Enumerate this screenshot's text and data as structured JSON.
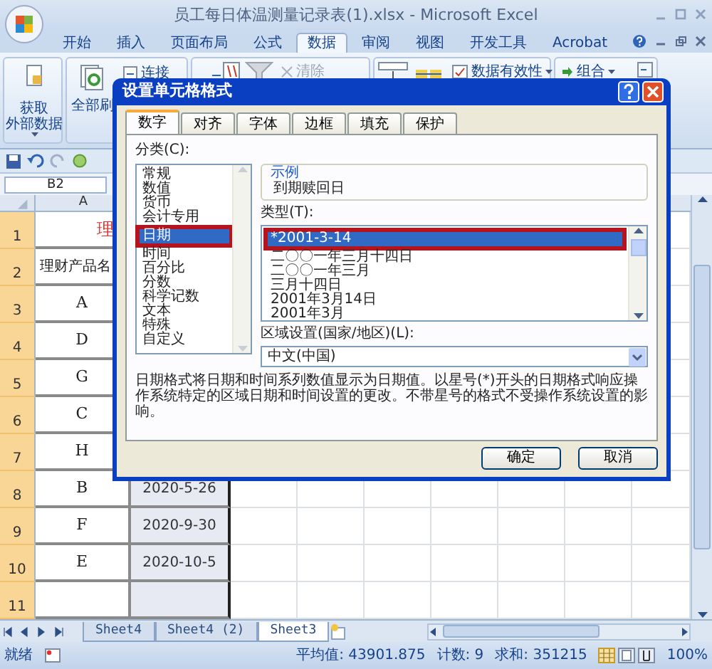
{
  "window": {
    "title": "员工每日体温测量记录表(1).xlsx - Microsoft Excel"
  },
  "ribbon_tabs": [
    {
      "label": "开始",
      "selected": false
    },
    {
      "label": "插入",
      "selected": false
    },
    {
      "label": "页面布局",
      "selected": false
    },
    {
      "label": "公式",
      "selected": false
    },
    {
      "label": "数据",
      "selected": true
    },
    {
      "label": "审阅",
      "selected": false
    },
    {
      "label": "视图",
      "selected": false
    },
    {
      "label": "开发工具",
      "selected": false
    },
    {
      "label": "Acrobat",
      "selected": false
    }
  ],
  "ribbon": {
    "get_data": {
      "lines": [
        "获取",
        "外部数据"
      ]
    },
    "refresh": {
      "label": "全部刷"
    },
    "connections": {
      "label": "连接",
      "disabled": false
    },
    "clear": {
      "label": "清除",
      "disabled": true
    },
    "validation": {
      "label": "数据有效性",
      "disabled": false
    },
    "group": {
      "label": "组合",
      "disabled": false
    }
  },
  "name_box": "B2",
  "columns": [
    "A"
  ],
  "rows": [
    {
      "header": "1",
      "kind": "title",
      "a": "理"
    },
    {
      "header": "2",
      "kind": "heading",
      "a": "理财产品名"
    },
    {
      "header": "3",
      "kind": "data",
      "a": "A"
    },
    {
      "header": "4",
      "kind": "data",
      "a": "D"
    },
    {
      "header": "5",
      "kind": "data",
      "a": "G"
    },
    {
      "header": "6",
      "kind": "data",
      "a": "C"
    },
    {
      "header": "7",
      "kind": "data",
      "a": "H"
    },
    {
      "header": "8",
      "kind": "data",
      "a": "B",
      "b": "2020-5-26",
      "b_selected": true
    },
    {
      "header": "9",
      "kind": "data",
      "a": "F",
      "b": "2020-9-30",
      "b_selected": true
    },
    {
      "header": "10",
      "kind": "data",
      "a": "E",
      "b": "2020-10-5",
      "b_selected": true
    },
    {
      "header": "11",
      "kind": "data",
      "b_selected": true
    }
  ],
  "sheet_tabs": [
    {
      "label": "Sheet4",
      "selected": false
    },
    {
      "label": "Sheet4 (2)",
      "selected": false
    },
    {
      "label": "Sheet3",
      "selected": true
    }
  ],
  "status_bar": {
    "ready": "就绪",
    "average": "平均值: 43901.875",
    "count": "计数: 9",
    "sum": "求和: 351215",
    "zoom": "100%"
  },
  "dialog": {
    "title": "设置单元格格式",
    "tabs": [
      {
        "label": "数字",
        "selected": true
      },
      {
        "label": "对齐",
        "selected": false
      },
      {
        "label": "字体",
        "selected": false
      },
      {
        "label": "边框",
        "selected": false
      },
      {
        "label": "填充",
        "selected": false
      },
      {
        "label": "保护",
        "selected": false
      }
    ],
    "category_label": "分类(C):",
    "categories": [
      {
        "label": "常规",
        "selected": false,
        "highlighted": false
      },
      {
        "label": "数值",
        "selected": false,
        "highlighted": false
      },
      {
        "label": "货币",
        "selected": false,
        "highlighted": false
      },
      {
        "label": "会计专用",
        "selected": false,
        "highlighted": false
      },
      {
        "label": "日期",
        "selected": true,
        "highlighted": true
      },
      {
        "label": "时间",
        "selected": false,
        "highlighted": false
      },
      {
        "label": "百分比",
        "selected": false,
        "highlighted": false
      },
      {
        "label": "分数",
        "selected": false,
        "highlighted": false
      },
      {
        "label": "科学记数",
        "selected": false,
        "highlighted": false
      },
      {
        "label": "文本",
        "selected": false,
        "highlighted": false
      },
      {
        "label": "特殊",
        "selected": false,
        "highlighted": false
      },
      {
        "label": "自定义",
        "selected": false,
        "highlighted": false
      }
    ],
    "sample": {
      "legend": "示例",
      "value": "到期赎回日"
    },
    "type_label": "类型(T):",
    "types": [
      {
        "label": "*2001-3-14",
        "selected": true,
        "highlighted": true
      },
      {
        "label": "二〇〇一年三月十四日",
        "selected": false,
        "highlighted": false
      },
      {
        "label": "二〇〇一年三月",
        "selected": false,
        "highlighted": false
      },
      {
        "label": "三月十四日",
        "selected": false,
        "highlighted": false
      },
      {
        "label": "2001年3月14日",
        "selected": false,
        "highlighted": false
      },
      {
        "label": "2001年3月",
        "selected": false,
        "highlighted": false
      }
    ],
    "locale_label": "区域设置(国家/地区)(L):",
    "locale_value": "中文(中国)",
    "description": "日期格式将日期和时间系列数值显示为日期值。以星号(*)开头的日期格式响应操作系统特定的区域日期和时间设置的更改。不带星号的格式不受操作系统设置的影响。",
    "buttons": [
      "确定",
      "取消"
    ]
  }
}
